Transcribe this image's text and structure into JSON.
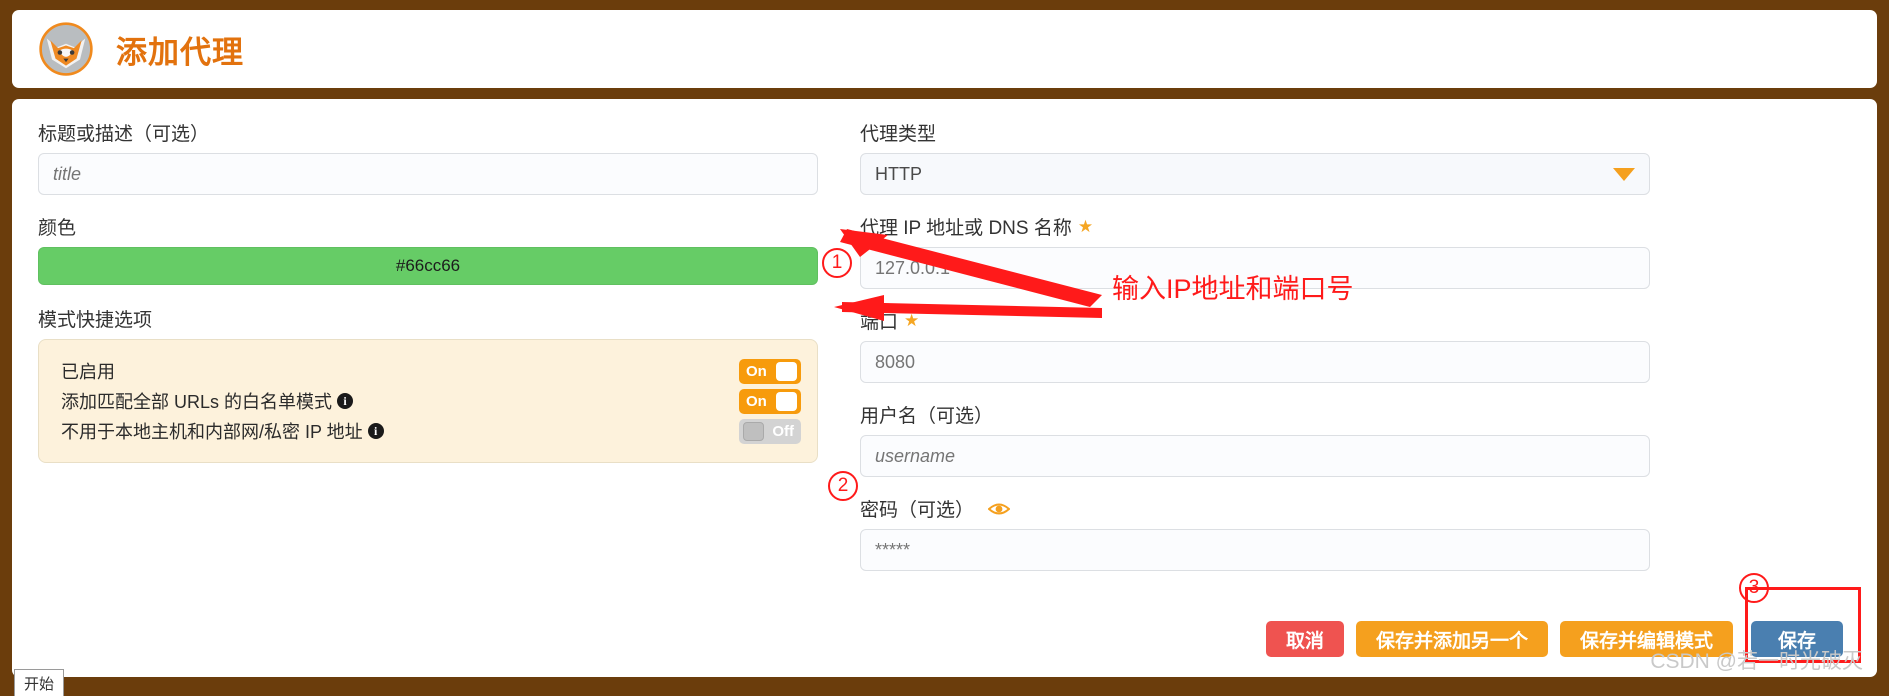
{
  "header": {
    "title": "添加代理",
    "logo_icon": "foxyproxy-fox-icon"
  },
  "left_column": {
    "title_field": {
      "label": "标题或描述（可选）",
      "placeholder": "title",
      "value": ""
    },
    "color_field": {
      "label": "颜色",
      "value": "#66cc66",
      "swatch_color": "#66cc66"
    },
    "mode_shortcuts": {
      "label": "模式快捷选项",
      "options": [
        {
          "label": "已启用",
          "has_info_icon": false,
          "state": "On"
        },
        {
          "label": "添加匹配全部 URLs 的白名单模式",
          "has_info_icon": true,
          "state": "On"
        },
        {
          "label": "不用于本地主机和内部网/私密 IP 地址",
          "has_info_icon": true,
          "state": "Off"
        }
      ]
    }
  },
  "right_column": {
    "proxy_type": {
      "label": "代理类型",
      "selected": "HTTP",
      "caret_icon": "chevron-down-icon"
    },
    "proxy_host": {
      "label": "代理 IP 地址或 DNS 名称",
      "required_icon": "star-icon",
      "placeholder": "127.0.0.1",
      "value": ""
    },
    "port": {
      "label": "端口",
      "required_icon": "star-icon",
      "placeholder": "8080",
      "value": ""
    },
    "username": {
      "label": "用户名（可选）",
      "placeholder": "username",
      "value": ""
    },
    "password": {
      "label": "密码（可选）",
      "eye_icon": "eye-icon",
      "placeholder": "*****",
      "value": ""
    }
  },
  "buttons": {
    "cancel": "取消",
    "save_and_add_another": "保存并添加另一个",
    "save_and_edit_patterns": "保存并编辑模式",
    "save": "保存"
  },
  "annotations": {
    "marker_1": "1",
    "marker_2": "2",
    "marker_3": "3",
    "note_text": "输入IP地址和端口号",
    "color": "#ff1a1a"
  },
  "footer": {
    "start_tab": "开始",
    "watermark": "CSDN @若一时光破灭"
  },
  "theme": {
    "frame": "#6b3d0c",
    "title_color": "#e2720e",
    "accent_orange": "#f5a01e",
    "save_blue": "#4a7fb0",
    "cancel_red": "#ef5350",
    "mode_panel_bg": "#fdf2dc"
  }
}
